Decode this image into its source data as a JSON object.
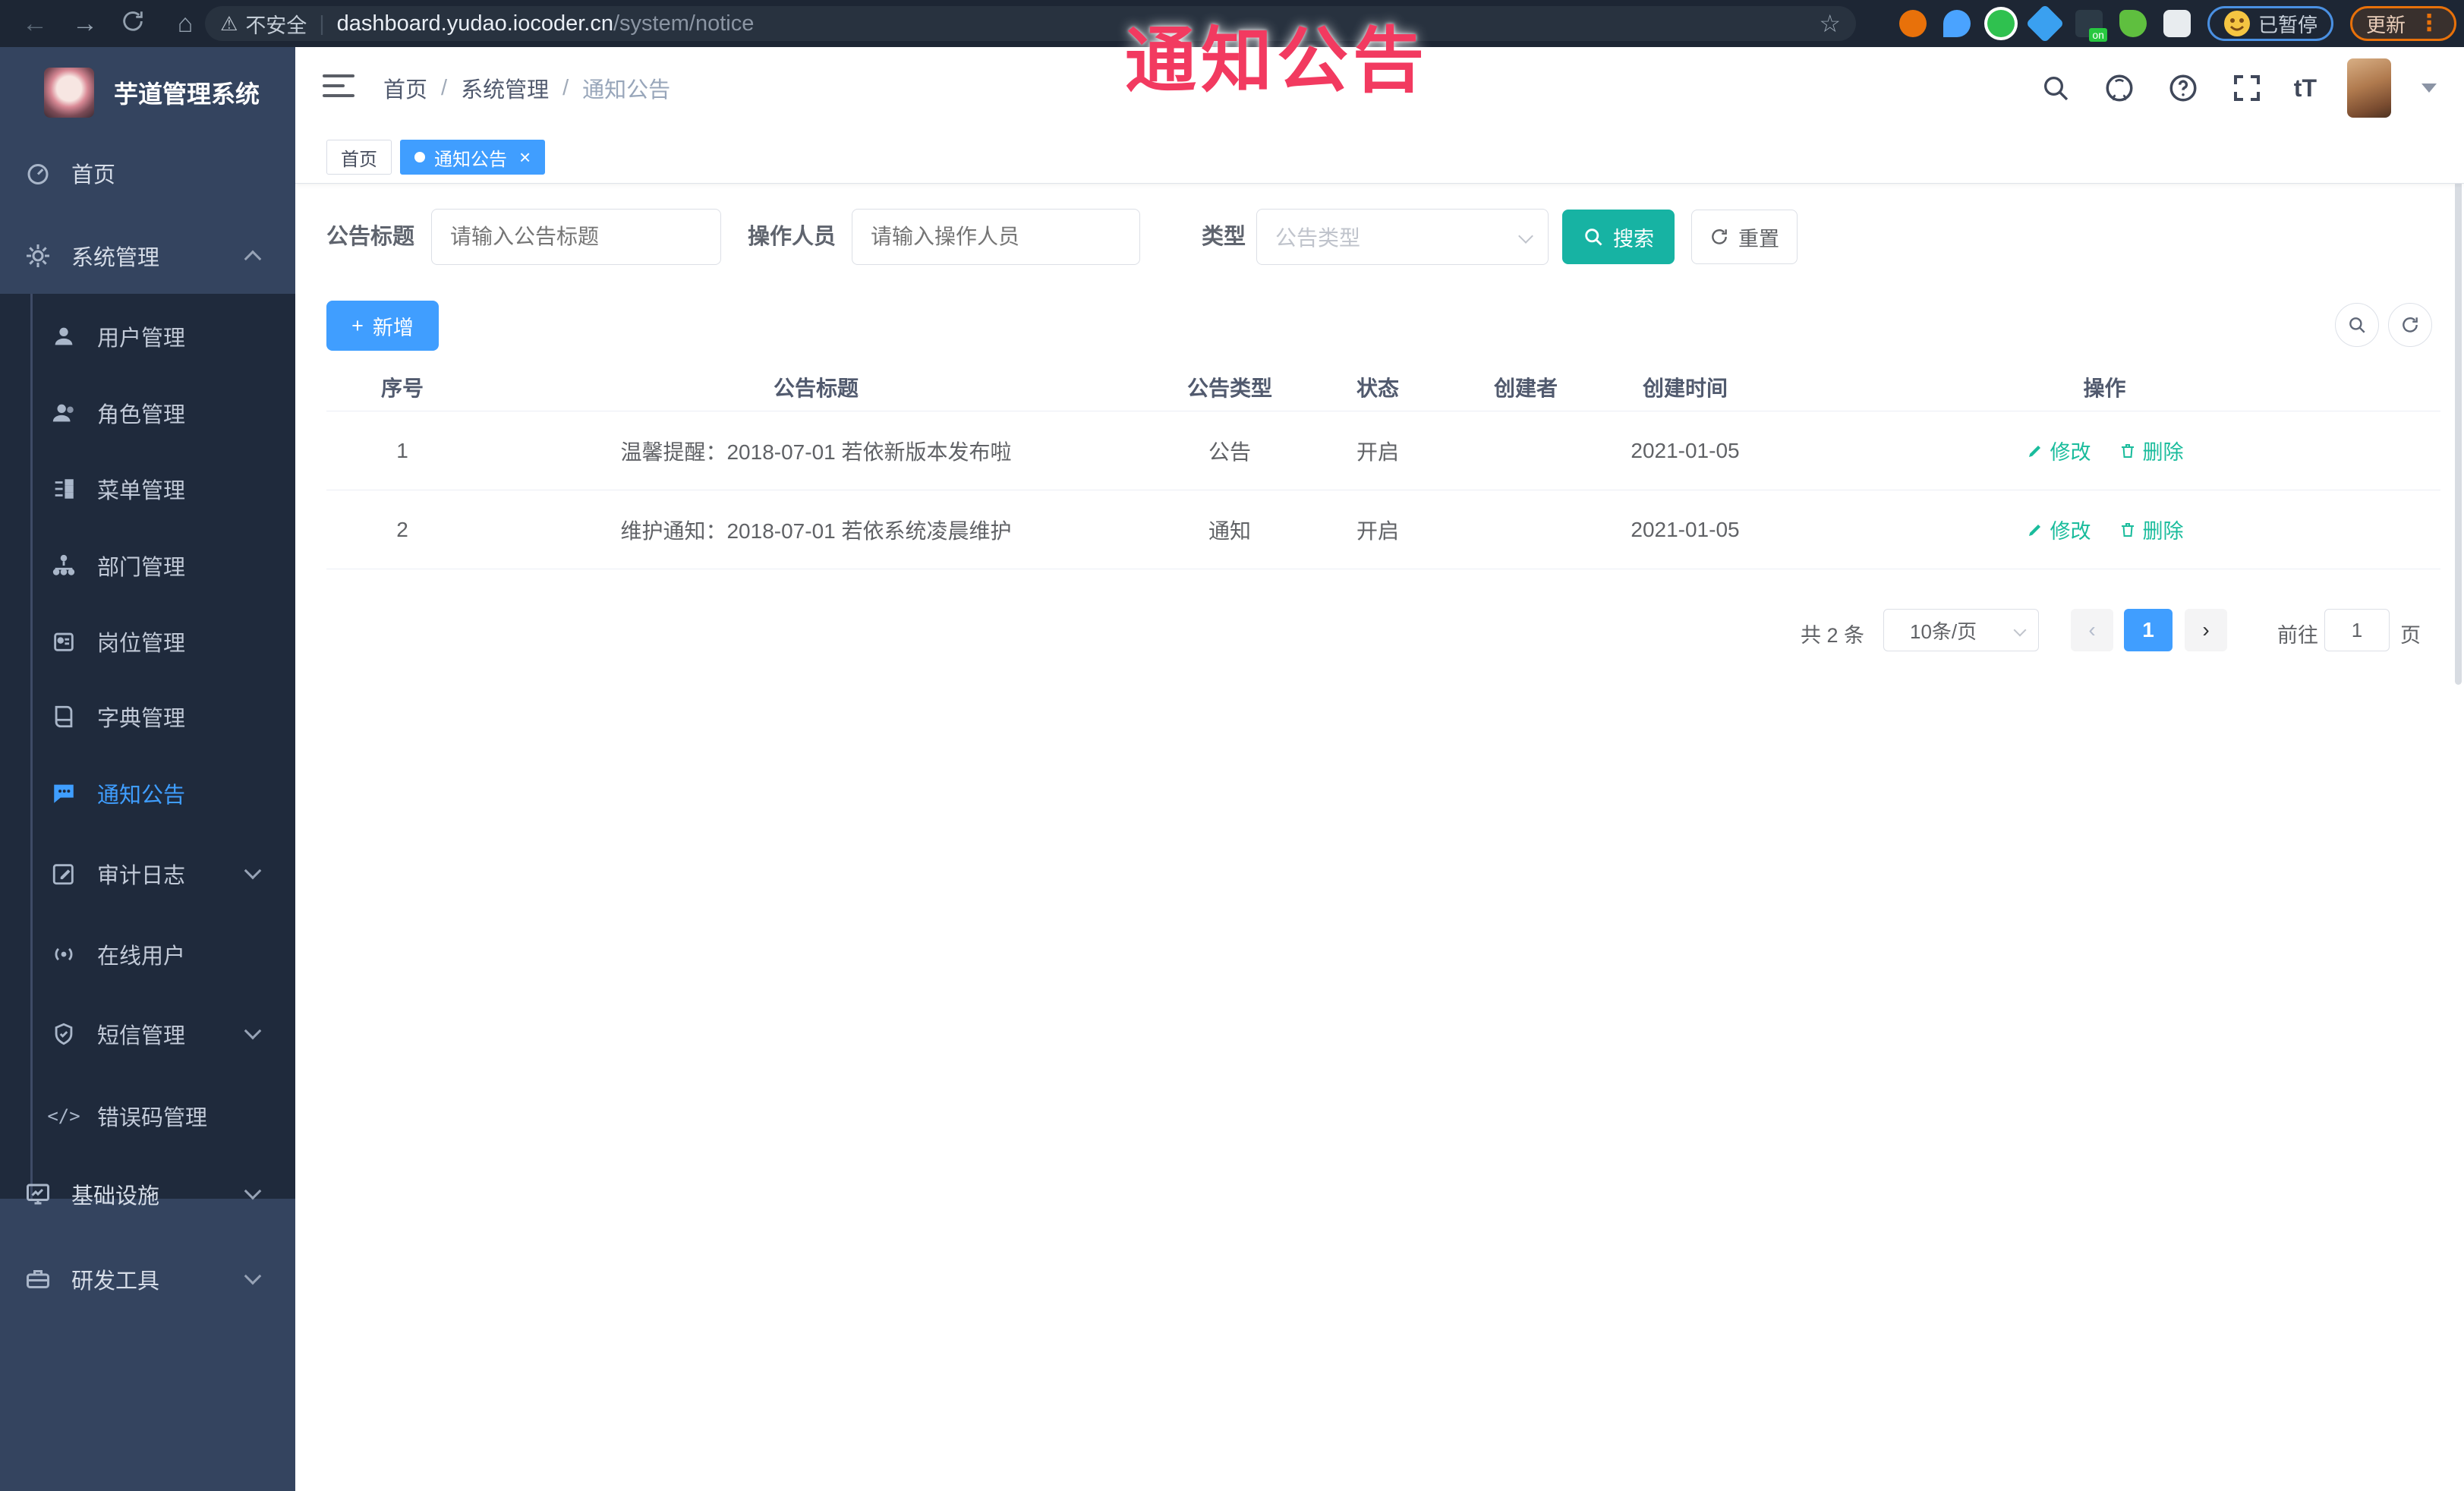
{
  "annotation": {
    "label": "通知公告"
  },
  "browser": {
    "security_label": "不安全",
    "url_host": "dashboard.yudao.iocoder.cn",
    "url_path": "/system/notice",
    "paused_label": "已暂停",
    "update_label": "更新",
    "extension_on_badge": "on"
  },
  "sidebar": {
    "app_title": "芋道管理系统",
    "items": [
      {
        "label": "首页"
      },
      {
        "label": "系统管理"
      },
      {
        "label": "用户管理"
      },
      {
        "label": "角色管理"
      },
      {
        "label": "菜单管理"
      },
      {
        "label": "部门管理"
      },
      {
        "label": "岗位管理"
      },
      {
        "label": "字典管理"
      },
      {
        "label": "通知公告"
      },
      {
        "label": "审计日志"
      },
      {
        "label": "在线用户"
      },
      {
        "label": "短信管理"
      },
      {
        "label": "错误码管理"
      },
      {
        "label": "基础设施"
      },
      {
        "label": "研发工具"
      }
    ]
  },
  "header": {
    "breadcrumb": {
      "home": "首页",
      "section": "系统管理",
      "current": "通知公告"
    }
  },
  "tabs": {
    "home": "首页",
    "active": "通知公告"
  },
  "filters": {
    "title_label": "公告标题",
    "title_placeholder": "请输入公告标题",
    "operator_label": "操作人员",
    "operator_placeholder": "请输入操作人员",
    "type_label": "类型",
    "type_placeholder": "公告类型",
    "search_label": "搜索",
    "reset_label": "重置"
  },
  "toolbar": {
    "add_label": "新增"
  },
  "table": {
    "columns": [
      "序号",
      "公告标题",
      "公告类型",
      "状态",
      "创建者",
      "创建时间",
      "操作"
    ],
    "rows": [
      {
        "index": "1",
        "title": "温馨提醒：2018-07-01 若依新版本发布啦",
        "type": "公告",
        "status": "开启",
        "creator": "",
        "created": "2021-01-05"
      },
      {
        "index": "2",
        "title": "维护通知：2018-07-01 若依系统凌晨维护",
        "type": "通知",
        "status": "开启",
        "creator": "",
        "created": "2021-01-05"
      }
    ],
    "ops": {
      "edit": "修改",
      "delete": "删除"
    }
  },
  "pagination": {
    "total": "共 2 条",
    "page_size": "10条/页",
    "current_page": "1",
    "jump_prefix": "前往",
    "jump_value": "1",
    "jump_suffix": "页"
  },
  "colors": {
    "primary": "#409eff",
    "search_teal": "#17b3a3",
    "op_link": "#1abc9c",
    "annotation": "#f23a60"
  }
}
